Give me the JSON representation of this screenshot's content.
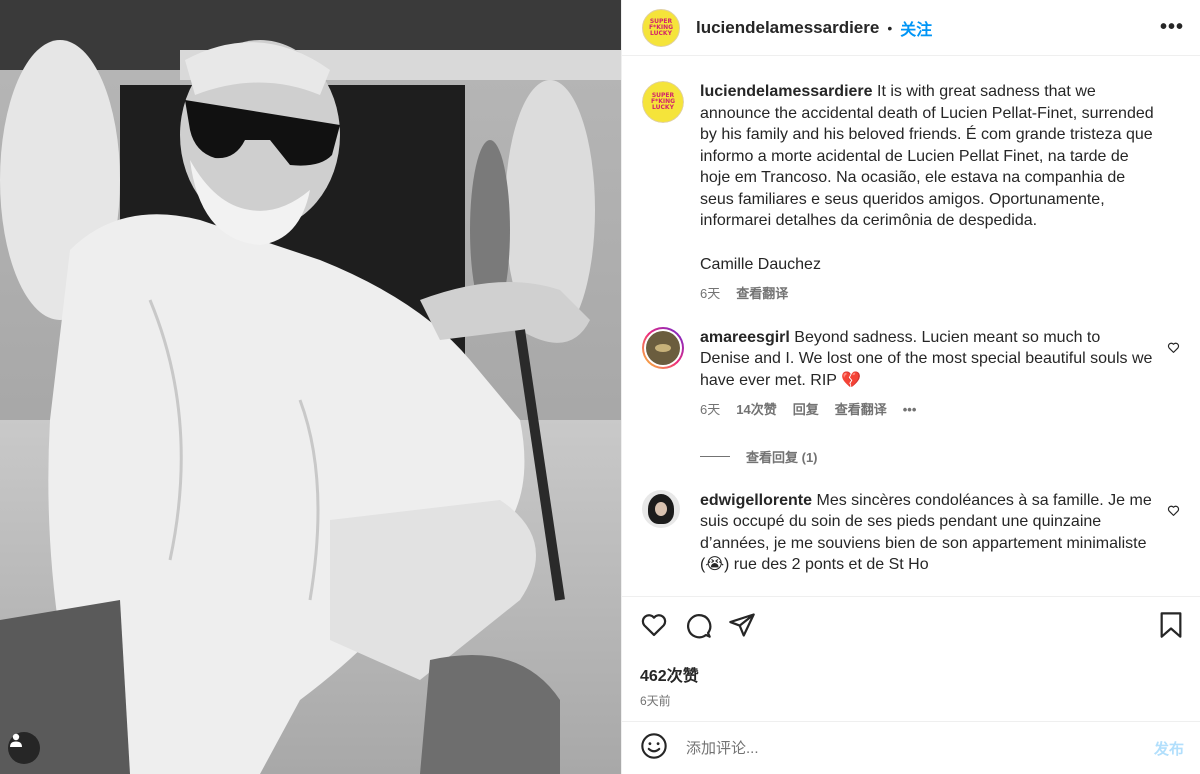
{
  "post": {
    "username": "luciendelamessardiere",
    "follow_label": "关注",
    "more_label": "•••",
    "separator": "•",
    "logo_text": [
      "SUPER",
      "F*KING",
      "LUCKY"
    ]
  },
  "caption": {
    "username": "luciendelamessardiere",
    "text": "It is with great sadness that we announce the accidental death of Lucien Pellat-Finet, surrended by his family and his beloved friends. É com grande tristeza que informo a morte acidental de Lucien Pellat Finet, na tarde de hoje em Trancoso. Na ocasião, ele estava na companhia de seus familiares e seus queridos amigos. Oportunamente, informarei detalhes da cerimônia de despedida.",
    "signature": "Camille Dauchez",
    "time": "6天",
    "translate": "查看翻译"
  },
  "comments": [
    {
      "username": "amareesgirl",
      "text": "Beyond sadness. Lucien meant so much to Denise and I. We lost one of the most special beautiful souls we have ever met. RIP 💔",
      "time": "6天",
      "likes": "14次赞",
      "reply": "回复",
      "translate": "查看翻译",
      "more": "•••",
      "view_replies": "查看回复 (1)"
    },
    {
      "username": "edwigellorente",
      "text": "Mes sincères condoléances à sa famille. Je me suis occupé du soin de ses pieds pendant une quinzaine d’années, je me souviens bien de son appartement minimaliste (😭) rue des 2 ponts et de St Ho"
    }
  ],
  "stats": {
    "likes": "462次赞",
    "ago": "6天前"
  },
  "add_comment": {
    "placeholder": "添加评论...",
    "post_label": "发布"
  },
  "colors": {
    "accent": "#0095f6",
    "post_disabled": "#b2dffc",
    "secondary_text": "#737373",
    "logo_yellow": "#f5e43a",
    "logo_pink": "#d2236a"
  },
  "icons": [
    "heart-icon",
    "comment-icon",
    "share-icon",
    "bookmark-icon",
    "emoji-icon",
    "user-tag-icon",
    "more-icon"
  ]
}
